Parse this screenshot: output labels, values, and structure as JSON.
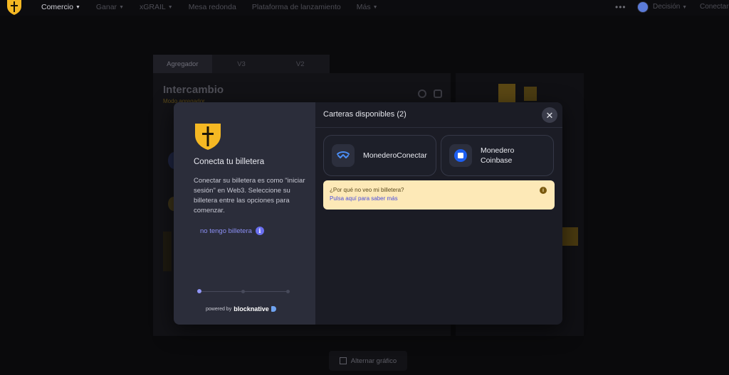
{
  "nav": {
    "items": [
      {
        "label": "Comercio",
        "chevron": true,
        "active": true
      },
      {
        "label": "Ganar",
        "chevron": true
      },
      {
        "label": "xGRAIL",
        "chevron": true
      },
      {
        "label": "Mesa redonda",
        "chevron": false
      },
      {
        "label": "Plataforma de lanzamiento",
        "chevron": false
      },
      {
        "label": "Más",
        "chevron": true
      }
    ],
    "more_dots": "•••",
    "account_label": "Decisión",
    "connect_label": "Conectar"
  },
  "swap_bg": {
    "tabs": [
      "Agregador",
      "V3",
      "V2"
    ],
    "title": "Intercambio",
    "subtitle": "Modo agregador",
    "chart_toggle": "Alternar gráfico"
  },
  "modal": {
    "left": {
      "title": "Conecta tu billetera",
      "description": "Conectar su billetera es como \"iniciar sesión\" en Web3. Seleccione su billetera entre las opciones para comenzar.",
      "no_wallet": "no tengo billetera",
      "powered_by": "powered by",
      "brand": "blocknative",
      "step_current": 1,
      "step_total": 3
    },
    "header": {
      "title": "Carteras disponibles (2)",
      "close_symbol": "✕"
    },
    "wallets": [
      {
        "name": "MonederoConectar",
        "icon": "walletconnect-icon"
      },
      {
        "name": "Monedero Coinbase",
        "icon": "coinbase-icon"
      }
    ],
    "notice": {
      "question": "¿Por qué no veo mi billetera?",
      "link": "Pulsa aquí para saber más"
    }
  },
  "colors": {
    "accent": "#f5b823",
    "link": "#8b8ff4",
    "notice_bg": "#fde9b7",
    "coinbase": "#1d5ef0"
  }
}
